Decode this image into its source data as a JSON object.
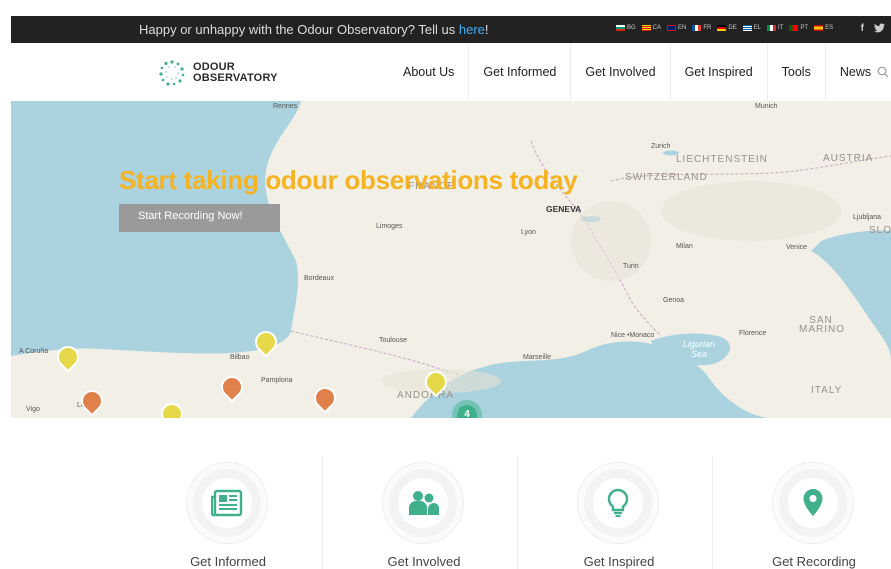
{
  "topbar": {
    "message": "Happy or unhappy with the Odour Observatory? Tell us ",
    "link": "here",
    "suffix": "!",
    "languages": [
      {
        "code": "BG",
        "color": "#d62612"
      },
      {
        "code": "CA",
        "color": "#fcdd09"
      },
      {
        "code": "EN",
        "color": "#012169"
      },
      {
        "code": "FR",
        "color": "#0055a4"
      },
      {
        "code": "DE",
        "color": "#ffce00"
      },
      {
        "code": "EL",
        "color": "#0d5eaf"
      },
      {
        "code": "IT",
        "color": "#009246"
      },
      {
        "code": "PT",
        "color": "#ff0000"
      },
      {
        "code": "ES",
        "color": "#c60b1e"
      }
    ],
    "social": [
      "facebook-icon",
      "twitter-icon"
    ]
  },
  "header": {
    "logo_line1": "ODOUR",
    "logo_line2": "OBSERVATORY",
    "nav": [
      "About Us",
      "Get Informed",
      "Get Involved",
      "Get Inspired",
      "Tools",
      "News"
    ]
  },
  "hero": {
    "headline": "Start taking odour observations today",
    "cta": "Start Recording Now!",
    "cluster_count": "4",
    "map_labels": {
      "rennes": "Rennes",
      "munich": "Munich",
      "zurich": "Zurich",
      "liechtenstein": "LIECHTENSTEIN",
      "austria": "AUSTRIA",
      "france": "FRANCE",
      "switzerland": "SWITZERLAND",
      "geneva": "GENEVA",
      "limoges": "Limoges",
      "lyon": "Lyon",
      "ljubljana": "Ljubljana",
      "slo": "SLOV",
      "milan": "Milan",
      "venice": "Venice",
      "turin": "Turin",
      "bordeaux": "Bordeaux",
      "genoa": "Genoa",
      "san_marino": "SAN MARINO",
      "toulouse": "Toulouse",
      "nice_monaco": "Nice •Monaco",
      "ligurian_sea": "Ligurian Sea",
      "florence": "Florence",
      "coruna": "A Coruña",
      "bilbao": "Bilbao",
      "marseille": "Marseille",
      "pamplona": "Pamplona",
      "italy": "ITALY",
      "andorra": "ANDORRA",
      "vigo": "Vigo",
      "leon": "Leon"
    }
  },
  "features": [
    {
      "label": "Get Informed",
      "icon": "newspaper-icon"
    },
    {
      "label": "Get Involved",
      "icon": "people-icon"
    },
    {
      "label": "Get Inspired",
      "icon": "lightbulb-icon"
    },
    {
      "label": "Get Recording",
      "icon": "map-pin-icon"
    }
  ],
  "colors": {
    "accent_green": "#40b08c",
    "headline_yellow": "#f5b324",
    "link_blue": "#3db0f7",
    "topbar_bg": "#222222"
  }
}
